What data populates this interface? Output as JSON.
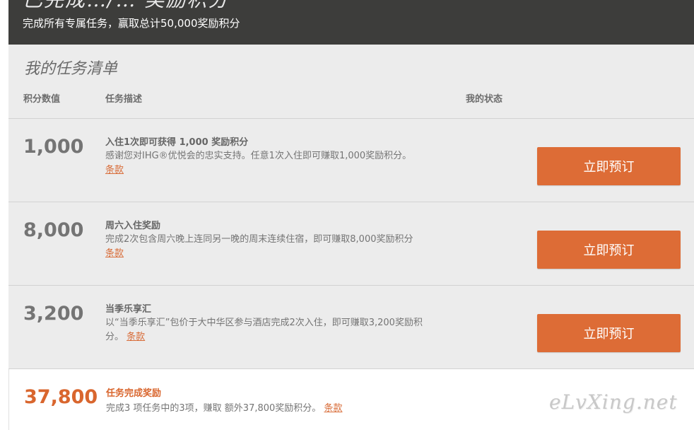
{
  "banner": {
    "title_partial": "已完成…/… 奖励积分",
    "subtitle": "完成所有专属任务，赢取总计50,000奖励积分"
  },
  "list": {
    "title": "我的任务清单",
    "headers": {
      "points": "积分数值",
      "description": "任务描述",
      "status": "我的状态"
    },
    "tasks": [
      {
        "points": "1,000",
        "title": "入住1次即可获得 1,000 奖励积分",
        "description": "感谢您对IHG®优悦会的忠实支持。任意1次入住即可赚取1,000奖励积分。",
        "terms": "条款",
        "button": "立即预订"
      },
      {
        "points": "8,000",
        "title": "周六入住奖励",
        "description": "完成2次包含周六晚上连同另一晚的周末连续住宿，即可赚取8,000奖励积分",
        "terms": "条款",
        "button": "立即预订"
      },
      {
        "points": "3,200",
        "title": "当季乐享汇",
        "description": "以“当季乐享汇”包价于大中华区参与酒店完成2次入住，即可赚取3,200奖励积分。",
        "terms": "条款",
        "button": "立即预订"
      }
    ]
  },
  "bonus": {
    "points": "37,800",
    "title": "任务完成奖励",
    "description": "完成3 项任务中的3项，赚取 额外37,800奖励积分。",
    "terms": "条款"
  },
  "watermark": "eLvXing.net",
  "colors": {
    "banner_bg": "#3d3d3b",
    "panel_bg": "#ececec",
    "accent_orange": "#dd6c36",
    "text_gray": "#747474"
  }
}
